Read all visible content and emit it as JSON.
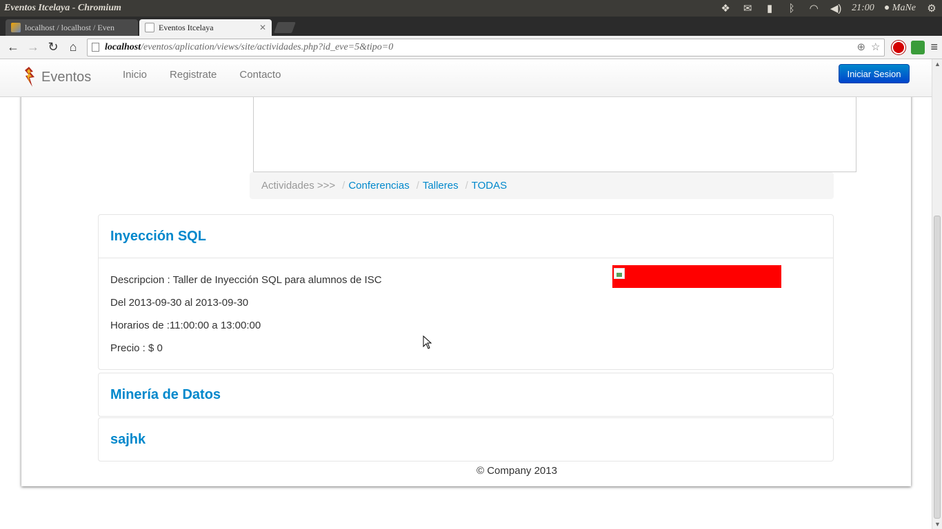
{
  "os_bar": {
    "window_title": "Eventos Itcelaya - Chromium",
    "clock": "21:00",
    "user": "MaNe"
  },
  "tabs": [
    {
      "label": "localhost / localhost / Even",
      "favicon": "phpmyadmin-icon",
      "active": false
    },
    {
      "label": "Eventos Itcelaya",
      "favicon": "page-icon",
      "active": true
    }
  ],
  "toolbar": {
    "url_host": "localhost",
    "url_path": "/eventos/aplication/views/site/actividades.php?id_eve=5&tipo=0"
  },
  "navbar": {
    "brand": "Eventos",
    "links": [
      "Inicio",
      "Registrate",
      "Contacto"
    ],
    "login_button": "Iniciar Sesion"
  },
  "breadcrumb": {
    "label": "Actividades >>>",
    "separator": "/",
    "links": [
      "Conferencias",
      "Talleres",
      "TODAS"
    ]
  },
  "activities": [
    {
      "title": "Inyección SQL",
      "expanded": true,
      "lines": [
        "Descripcion : Taller de Inyección SQL para alumnos de ISC",
        "Del 2013-09-30 al 2013-09-30",
        "Horarios de :11:00:00 a 13:00:00",
        "Precio : $ 0"
      ]
    },
    {
      "title": "Minería de Datos",
      "expanded": false
    },
    {
      "title": "sajhk",
      "expanded": false
    }
  ],
  "footer": "© Company 2013",
  "colors": {
    "link": "#0088cc",
    "button": "#0055cc",
    "image_placeholder": "#ff0000"
  }
}
